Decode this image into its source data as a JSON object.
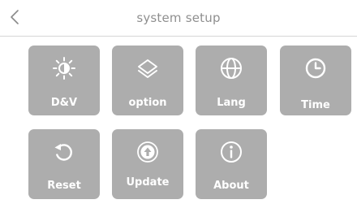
{
  "header": {
    "title": "system setup",
    "back_icon": "chevron-left-icon"
  },
  "colors": {
    "tile_bg": "#adadad",
    "tile_fg": "#ffffff",
    "title": "#8f8f8f"
  },
  "tiles": [
    {
      "label": "D&V",
      "icon": "brightness-icon"
    },
    {
      "label": "option",
      "icon": "layers-icon"
    },
    {
      "label": "Lang",
      "icon": "globe-icon"
    },
    {
      "label": "Time",
      "icon": "clock-icon"
    },
    {
      "label": "Reset",
      "icon": "reset-icon"
    },
    {
      "label": "Update",
      "icon": "upload-icon"
    },
    {
      "label": "About",
      "icon": "info-icon"
    }
  ]
}
